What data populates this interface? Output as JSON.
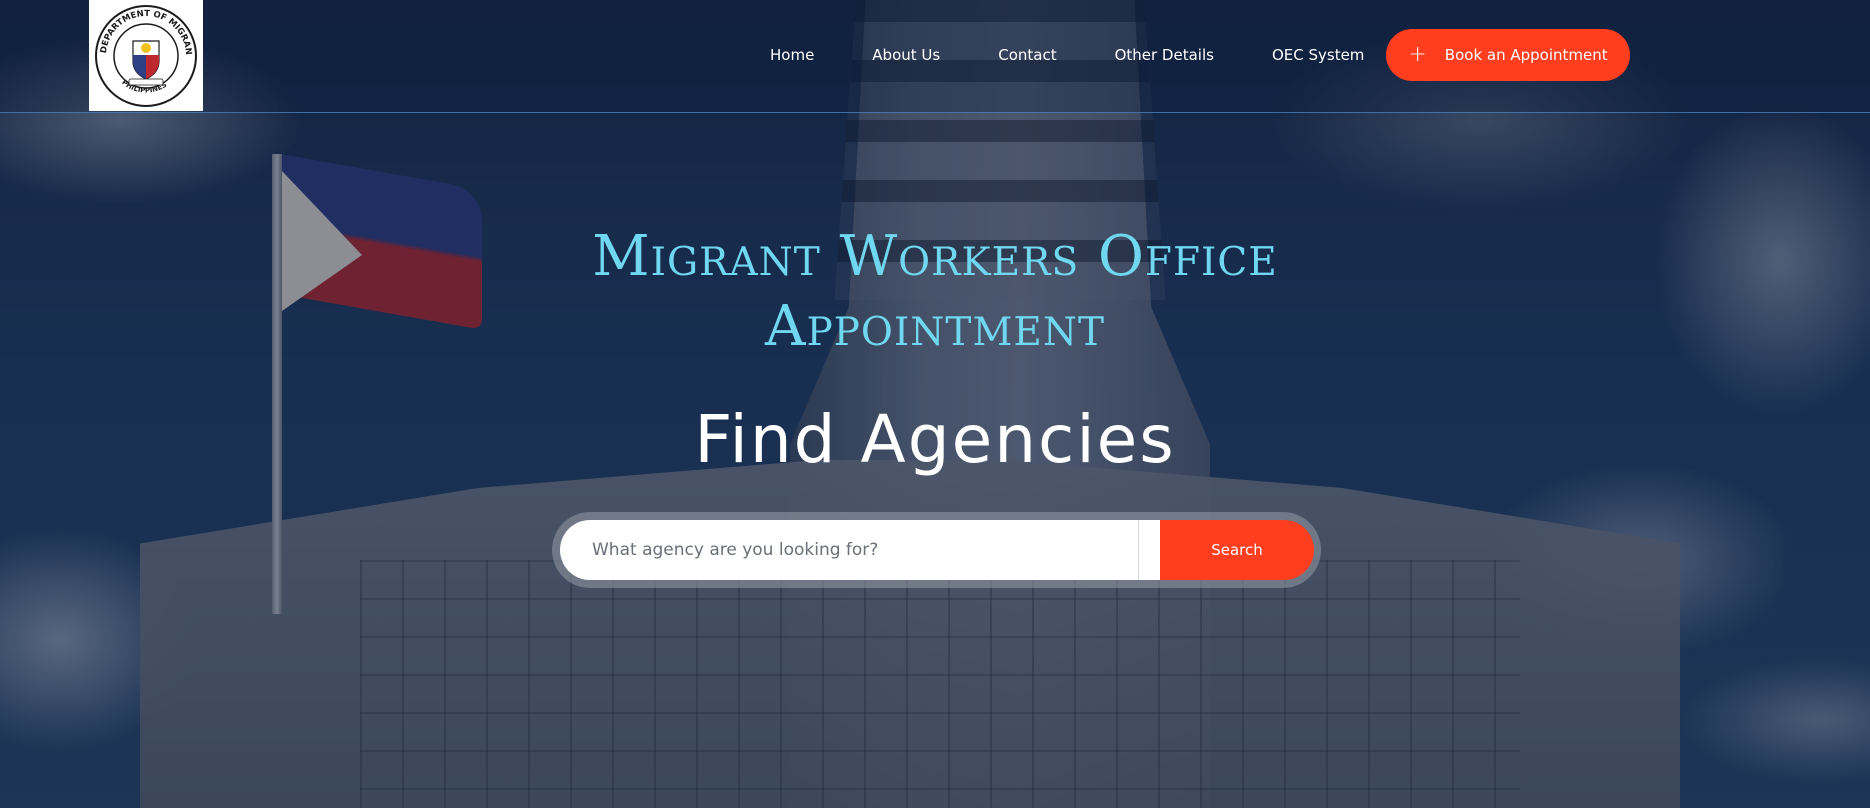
{
  "header": {
    "logo": {
      "icon": "department-of-migrant-workers-seal",
      "ring_text": "DEPARTMENT OF MIGRANT WORKERS",
      "bottom_text": "PHILIPPINES"
    },
    "nav": [
      {
        "label": "Home"
      },
      {
        "label": "About Us"
      },
      {
        "label": "Contact"
      },
      {
        "label": "Other Details"
      },
      {
        "label": "OEC System"
      }
    ],
    "book_button": {
      "icon": "plus-icon",
      "label": "Book an Appointment"
    }
  },
  "hero": {
    "title_line1": "Migrant Workers Office",
    "title_line2": "Appointment",
    "subtitle": "Find Agencies",
    "search": {
      "placeholder": "What agency are you looking for?",
      "value": "",
      "button_label": "Search"
    }
  },
  "colors": {
    "accent": "#ff3d1f",
    "title": "#6fd8f0",
    "header_border": "#508cd2"
  }
}
